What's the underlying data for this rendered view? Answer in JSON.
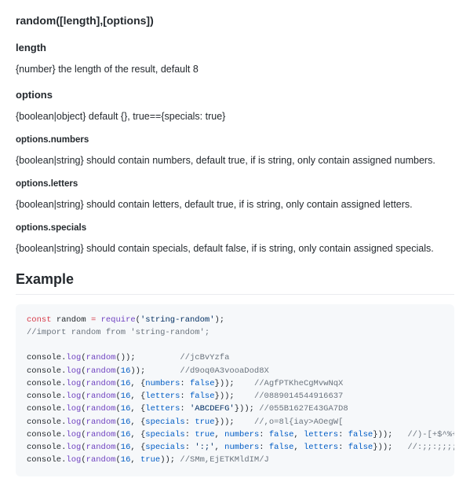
{
  "signature": "random([length],[options])",
  "params": {
    "length": {
      "title": "length",
      "desc": "{number} the length of the result, default 8"
    },
    "options": {
      "title": "options",
      "desc": "{boolean|object} default {}, true=={specials: true}"
    },
    "numbers": {
      "title": "options.numbers",
      "desc": "{boolean|string} should contain numbers, default true, if is string, only contain assigned numbers."
    },
    "letters": {
      "title": "options.letters",
      "desc": "{boolean|string} should contain letters, default true, if is string, only contain assigned letters."
    },
    "specials": {
      "title": "options.specials",
      "desc": "{boolean|string} should contain specials, default false, if is string, only contain assigned specials."
    }
  },
  "example_heading": "Example",
  "code": {
    "require_module": "'string-random'",
    "import_comment": "//import random from 'string-random';",
    "lines": [
      {
        "args": "",
        "comment": "//jcBvYzfa",
        "pad": "         "
      },
      {
        "args": "16",
        "comment": "//d9oq0A3vooaDod8X",
        "pad": "       "
      },
      {
        "args_pre": "16, {",
        "prop": "numbers",
        "args_post": ": ",
        "val": "false",
        "tail": "}",
        "comment": "//AgfPTKheCgMvwNqX",
        "pad": "    "
      },
      {
        "args_pre": "16, {",
        "prop": "letters",
        "args_post": ": ",
        "val": "false",
        "tail": "}",
        "comment": "//0889014544916637",
        "pad": "    "
      },
      {
        "args_pre": "16, {",
        "prop": "letters",
        "args_post": ": ",
        "str": "'ABCDEFG'",
        "tail": "}",
        "comment": "//055B1627E43GA7D8",
        "pad": " "
      },
      {
        "args_pre": "16, {",
        "prop": "specials",
        "args_post": ": ",
        "val": "true",
        "tail": "}",
        "comment": "//,o=8l{iay>AOegW[",
        "pad": "    "
      },
      {
        "multi": [
          {
            "prop": "specials",
            "val": "true"
          },
          {
            "prop": "numbers",
            "val": "false"
          },
          {
            "prop": "letters",
            "val": "false"
          }
        ],
        "comment": "//)-[+$^%+$|)-{(]%",
        "pad": "   "
      },
      {
        "multi": [
          {
            "prop": "specials",
            "str": "':;'"
          },
          {
            "prop": "numbers",
            "val": "false"
          },
          {
            "prop": "letters",
            "val": "false"
          }
        ],
        "comment": "//:;;:;;;;:;;;:;::",
        "pad": "   "
      },
      {
        "args_pre": "16, ",
        "val": "true",
        "tail": "",
        "comment": "//SMm,EjETKMldIM/J",
        "pad": " "
      }
    ]
  }
}
